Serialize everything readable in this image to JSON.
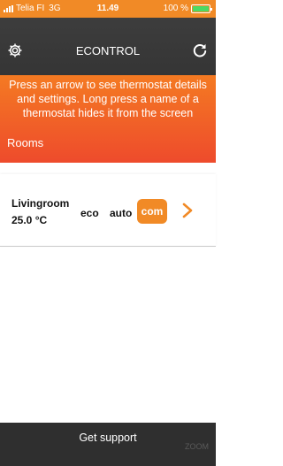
{
  "status_bar": {
    "carrier": "Telia FI",
    "network": "3G",
    "time": "11.49",
    "battery_text": "100 %",
    "battery_level": 1.0
  },
  "header": {
    "title": "ECONTROL",
    "settings_icon": "gear-icon",
    "refresh_icon": "refresh-icon"
  },
  "banner": {
    "info_text": "Press an arrow to see thermostat details and settings. Long press a name of a thermostat hides it from the screen",
    "rooms_label": "Rooms"
  },
  "rooms": [
    {
      "name": "Livingroom",
      "temperature": "25.0 °C",
      "modes": [
        "eco",
        "auto",
        "com"
      ],
      "active_mode": "com",
      "accent_color": "#f18a26"
    }
  ],
  "footer": {
    "support_label": "Get support",
    "watermark": "ZOOM"
  },
  "colors": {
    "accent": "#f18a26",
    "header_bg": "#3d3d3d",
    "banner_top": "#f47a22",
    "banner_bottom": "#ee4b2c",
    "footer_bg": "#2f2f2f"
  }
}
